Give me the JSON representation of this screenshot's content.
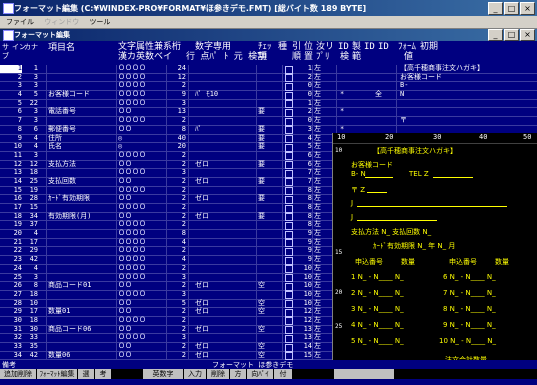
{
  "app": {
    "title": "フォーマット編集 (C:¥WINDEX-PRO¥FORMAT¥ほ参きデモ.FMT) [総バイト数 189 BYTE]",
    "controls": {
      "minimize": "_",
      "maximize": "□",
      "close": "×"
    }
  },
  "menu": {
    "file": "ファイル",
    "window": "ウィンドウ",
    "tool": "ツール"
  },
  "child": {
    "title": "フォーマット編集"
  },
  "header": {
    "subno": "サ",
    "sub2": "ブ",
    "inkana": "イン",
    "kana_label": "カナ",
    "name": "項目名",
    "cb_title": "文字属性兼系",
    "cb_sub": "漢カ英数ベイ",
    "len": "桁",
    "num_title": "数字専用",
    "num_sub": "行 点ﾊﾟ ﾄ 元 検割",
    "ed_sub": "",
    "req1": "ﾁｪｯ",
    "req2": "項",
    "clear": "種",
    "pos1": "引",
    "pos2": "順",
    "al1": "位",
    "al2": "置",
    "jstitle": "汝リ",
    "jssub": "ﾌﾟﾘ",
    "idtitle": "ID",
    "idsub": "検",
    "kt1": "製",
    "kt2": "範",
    "ids2": "ID",
    "ids3": "ID",
    "ft1": "ﾌｫｰﾑ",
    "ft2": "初期",
    "ft3": "値"
  },
  "rows": [
    {
      "no": "1",
      "sub": "1",
      "label": "",
      "cb": "ＯＯＯＯ",
      "len": "24",
      "ed": "",
      "req": "",
      "pos": "1",
      "al": "左",
      "mark": "",
      "kt": "",
      "cv": "【高千穂商事注文ハガキ】"
    },
    {
      "no": "2",
      "sub": "3",
      "label": "",
      "cb": "ＯＯＯＯ",
      "len": "12",
      "ed": "",
      "req": "",
      "pos": "2",
      "al": "左",
      "mark": "",
      "kt": "",
      "cv": "お客様コード"
    },
    {
      "no": "3",
      "sub": "3",
      "label": "",
      "cb": "ＯＯＯＯ",
      "len": "2",
      "ed": "",
      "req": "",
      "pos": "0",
      "al": "左",
      "mark": "",
      "kt": "",
      "cv": "B-"
    },
    {
      "no": "4",
      "sub": "5",
      "label": "お客様コード",
      "cb": "ＯＯＯＯ",
      "len": "9",
      "ed": "ﾊﾟ   ﾓ10",
      "req": "",
      "pos": "0",
      "al": "左",
      "mark": "*",
      "kt": "全",
      "cv": "N"
    },
    {
      "no": "5",
      "sub": "22",
      "label": "",
      "cb": "ＯＯＯＯ",
      "len": "3",
      "ed": "",
      "req": "",
      "pos": "1",
      "al": "左",
      "mark": "",
      "kt": "",
      "cv": ""
    },
    {
      "no": "6",
      "sub": "3",
      "label": "電話番号",
      "cb": "ＯＯ",
      "len": "13",
      "ed": "",
      "req": "要",
      "pos": "2",
      "al": "左",
      "mark": "*",
      "kt": "",
      "cv": ""
    },
    {
      "no": "7",
      "sub": "3",
      "label": "",
      "cb": "ＯＯＯＯ",
      "len": "2",
      "ed": "",
      "req": "",
      "pos": "0",
      "al": "左",
      "mark": "",
      "kt": "",
      "cv": "〒"
    },
    {
      "no": "8",
      "sub": "6",
      "label": "郵便番号",
      "cb": "ＯＯ",
      "len": "8",
      "ed": "ﾊﾟ",
      "req": "要",
      "pos": "3",
      "al": "左",
      "mark": "*",
      "kt": "",
      "cv": ""
    },
    {
      "no": "9",
      "sub": "4",
      "label": "住所",
      "cb": "◎",
      "len": "40",
      "ed": "",
      "req": "要",
      "pos": "4",
      "al": "左",
      "mark": "*",
      "kt": "",
      "cv": ""
    },
    {
      "no": "10",
      "sub": "4",
      "label": "氏名",
      "cb": "◎",
      "len": "20",
      "ed": "",
      "req": "要",
      "pos": "5",
      "al": "左",
      "mark": "*",
      "kt": "",
      "cv": ""
    },
    {
      "no": "11",
      "sub": "3",
      "label": "",
      "cb": "ＯＯＯＯ",
      "len": "2",
      "ed": "",
      "req": "",
      "pos": "6",
      "al": "左",
      "mark": "",
      "kt": "",
      "cv": ""
    },
    {
      "no": "12",
      "sub": "12",
      "label": "支払方法",
      "cb": "ＯＯ",
      "len": "2",
      "ed": "ゼロ",
      "req": "要",
      "pos": "6",
      "al": "左",
      "mark": "*",
      "kt": "",
      "cv": ""
    },
    {
      "no": "13",
      "sub": "18",
      "label": "",
      "cb": "ＯＯＯＯ",
      "len": "3",
      "ed": "",
      "req": "",
      "pos": "7",
      "al": "左",
      "mark": "",
      "kt": "",
      "cv": ""
    },
    {
      "no": "14",
      "sub": "25",
      "label": "支払回数",
      "cb": "ＯＯ",
      "len": "2",
      "ed": "ゼロ",
      "req": "要",
      "pos": "7",
      "al": "左",
      "mark": "*",
      "kt": "",
      "cv": ""
    },
    {
      "no": "15",
      "sub": "19",
      "label": "",
      "cb": "ＯＯＯＯ",
      "len": "2",
      "ed": "",
      "req": "",
      "pos": "8",
      "al": "左",
      "mark": "",
      "kt": "",
      "cv": ""
    },
    {
      "no": "16",
      "sub": "28",
      "label": "ｶｰﾄﾞ有効期限",
      "cb": "ＯＯ",
      "len": "2",
      "ed": "ゼロ",
      "req": "要",
      "pos": "8",
      "al": "左",
      "mark": "*",
      "kt": "",
      "cv": ""
    },
    {
      "no": "17",
      "sub": "15",
      "label": "",
      "cb": "ＯＯＯＯ",
      "len": "2",
      "ed": "",
      "req": "",
      "pos": "8",
      "al": "左",
      "mark": "",
      "kt": "",
      "cv": ""
    },
    {
      "no": "18",
      "sub": "34",
      "label": "有効期限(月)",
      "cb": "ＯＯ",
      "len": "2",
      "ed": "ゼロ",
      "req": "要",
      "pos": "8",
      "al": "左",
      "mark": "*",
      "kt": "",
      "cv": ""
    },
    {
      "no": "19",
      "sub": "37",
      "label": "",
      "cb": "ＯＯＯＯ",
      "len": "2",
      "ed": "",
      "req": "",
      "pos": "8",
      "al": "左",
      "mark": "",
      "kt": "",
      "cv": ""
    },
    {
      "no": "20",
      "sub": "4",
      "label": "",
      "cb": "ＯＯＯＯ",
      "len": "8",
      "ed": "",
      "req": "",
      "pos": "9",
      "al": "左",
      "mark": "",
      "kt": "",
      "cv": ""
    },
    {
      "no": "21",
      "sub": "17",
      "label": "",
      "cb": "ＯＯＯＯ",
      "len": "4",
      "ed": "",
      "req": "",
      "pos": "9",
      "al": "左",
      "mark": "",
      "kt": "",
      "cv": ""
    },
    {
      "no": "22",
      "sub": "29",
      "label": "",
      "cb": "ＯＯＯＯ",
      "len": "2",
      "ed": "",
      "req": "",
      "pos": "9",
      "al": "左",
      "mark": "",
      "kt": "",
      "cv": ""
    },
    {
      "no": "23",
      "sub": "42",
      "label": "",
      "cb": "ＯＯＯＯ",
      "len": "4",
      "ed": "",
      "req": "",
      "pos": "9",
      "al": "左",
      "mark": "",
      "kt": "",
      "cv": ""
    },
    {
      "no": "24",
      "sub": "4",
      "label": "",
      "cb": "ＯＯＯＯ",
      "len": "2",
      "ed": "",
      "req": "",
      "pos": "10",
      "al": "左",
      "mark": "",
      "kt": "",
      "cv": ""
    },
    {
      "no": "25",
      "sub": "3",
      "label": "",
      "cb": "ＯＯＯＯ",
      "len": "3",
      "ed": "",
      "req": "",
      "pos": "10",
      "al": "左",
      "mark": "",
      "kt": "",
      "cv": ""
    },
    {
      "no": "26",
      "sub": "8",
      "label": "商品コード01",
      "cb": "ＯＯ",
      "len": "2",
      "ed": "ゼロ",
      "req": "空",
      "pos": "10",
      "al": "左",
      "mark": "*",
      "kt": "",
      "cv": ""
    },
    {
      "no": "27",
      "sub": "18",
      "label": "",
      "cb": "ＯＯＯＯ",
      "len": "3",
      "ed": "",
      "req": "",
      "pos": "10",
      "al": "左",
      "mark": "",
      "kt": "",
      "cv": ""
    },
    {
      "no": "28",
      "sub": "10",
      "label": "",
      "cb": "ＯＯ",
      "len": "5",
      "ed": "ゼロ",
      "req": "空",
      "pos": "10",
      "al": "左",
      "mark": "*",
      "kt": "",
      "cv": ""
    },
    {
      "no": "29",
      "sub": "17",
      "label": "数量01",
      "cb": "ＯＯ",
      "len": "2",
      "ed": "ゼロ",
      "req": "空",
      "pos": "12",
      "al": "左",
      "mark": "*",
      "kt": "",
      "cv": ""
    },
    {
      "no": "30",
      "sub": "18",
      "label": "",
      "cb": "ＯＯＯＯ",
      "len": "2",
      "ed": "",
      "req": "",
      "pos": "12",
      "al": "左",
      "mark": "",
      "kt": "",
      "cv": ""
    },
    {
      "no": "31",
      "sub": "30",
      "label": "商品コード06",
      "cb": "ＯＯ",
      "len": "2",
      "ed": "ゼロ",
      "req": "空",
      "pos": "13",
      "al": "左",
      "mark": "*",
      "kt": "",
      "cv": ""
    },
    {
      "no": "32",
      "sub": "33",
      "label": "",
      "cb": "ＯＯＯＯ",
      "len": "3",
      "ed": "",
      "req": "",
      "pos": "13",
      "al": "左",
      "mark": "",
      "kt": "",
      "cv": ""
    },
    {
      "no": "33",
      "sub": "35",
      "label": "",
      "cb": "ＯＯ",
      "len": "2",
      "ed": "ゼロ",
      "req": "空",
      "pos": "14",
      "al": "左",
      "mark": "*",
      "kt": "",
      "cv": ""
    },
    {
      "no": "34",
      "sub": "42",
      "label": "数量06",
      "cb": "ＯＯ",
      "len": "2",
      "ed": "ゼロ",
      "req": "空",
      "pos": "15",
      "al": "左",
      "mark": "*",
      "kt": "",
      "cv": ""
    }
  ],
  "preview": {
    "ruler": [
      "10",
      "20",
      "30",
      "40",
      "50"
    ],
    "line_numbers": [
      "10",
      "15",
      "20",
      "25",
      "30"
    ],
    "title": "【高千穂商事注文ハガキ】",
    "customer_code": "お客様コード",
    "customer_code_prefix": "B- N",
    "tel": "TEL Z",
    "zip": "〒 Z",
    "addr_j1": "J",
    "addr_j2": "J",
    "payment": "支払方法 N_  支払回数 N_",
    "card_expiry": "ｶｰﾄﾞ有効期限 N_ 年 N_ 月",
    "col_app": "申込番号",
    "col_qty": "数量",
    "col_app2": "申込番号",
    "col_qty2": "数量",
    "items_left": [
      "1 N_ - N____  N_",
      "2 N_ - N____  N_",
      "3 N_ - N____  N_",
      "4 N_ - N____  N_",
      "5 N_ - N____  N_"
    ],
    "items_right": [
      "6 N_ - N____  N_",
      "7 N_ - N____  N_",
      "8 N_ - N____  N_",
      "9 N_ - N____  N_",
      "10 N_ - N____  N_"
    ],
    "total": "注文合計数量 __",
    "bottom_z": "Z"
  },
  "status": {
    "left": "備考",
    "center": "フォーマット ほ参きデモ"
  },
  "fkeys": [
    "追加削除",
    "ﾌｫｰﾏｯﾄ編集",
    "選",
    "考",
    "",
    "英数字",
    "入力",
    "削除",
    "方",
    "向ﾊﾟｲ",
    "付",
    "",
    "",
    "",
    ""
  ]
}
